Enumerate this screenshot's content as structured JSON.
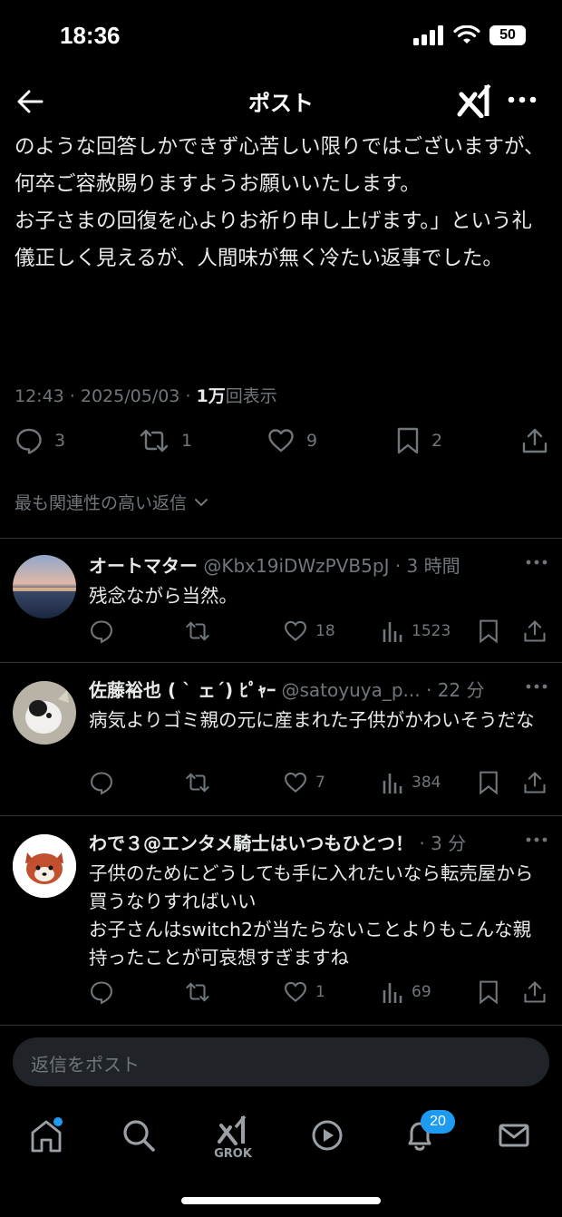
{
  "status": {
    "time": "18:36",
    "battery": "50"
  },
  "header": {
    "title": "ポスト"
  },
  "post": {
    "text": "のような回答しかできず心苦しい限りではございますが、何卒ご容赦賜りますようお願いいたします。\nお子さまの回復を心よりお祈り申し上げます。」という礼儀正しく見えるが、人間味が無く冷たい返事でした。",
    "time_date": "12:43 · 2025/05/03 · ",
    "views_count": "1万",
    "views_label": "回表示",
    "replies": "3",
    "reposts": "1",
    "likes": "9",
    "bookmarks": "2"
  },
  "sort_label": "最も関連性の高い返信",
  "replies": [
    {
      "name": "オートマター",
      "handle": " @Kbx19iDWzPVB5pJ · 3 時間",
      "text": "残念ながら当然。",
      "likes": "18",
      "views": "1523"
    },
    {
      "name": "佐藤裕也 ( ` ェ´) ﾋﾟｬｰ",
      "handle": " @satoyuya_p... · 22 分",
      "text": "病気よりゴミ親の元に産まれた子供がかわいそうだな",
      "likes": "7",
      "views": "384"
    },
    {
      "name": "わで３@エンタメ騎士はいつもひとつ！",
      "handle": " · 3 分",
      "text": "子供のためにどうしても手に入れたいなら転売屋から買うなりすればいい\nお子さんはswitch2が当たらないことよりもこんな親持ったことが可哀想すぎますね",
      "likes": "1",
      "views": "69"
    }
  ],
  "compose": {
    "placeholder": "返信をポスト"
  },
  "tabbar": {
    "grok_label": "GROK",
    "notifications_badge": "20"
  },
  "colors": {
    "background": "#000000",
    "text": "#e7e9ea",
    "muted": "#71767b",
    "accent": "#1d9bf0",
    "divider": "#2f3336"
  }
}
